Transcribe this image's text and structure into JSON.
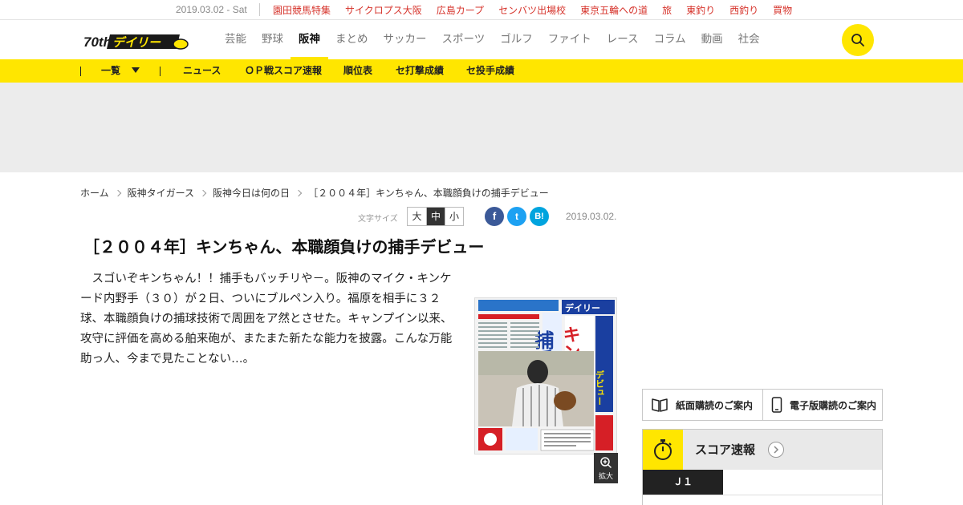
{
  "topbar": {
    "date": "2019.03.02 - Sat",
    "links": [
      "園田競馬特集",
      "サイクロプス大阪",
      "広島カープ",
      "センバツ出場校",
      "東京五輪への道",
      "旅",
      "東釣り",
      "西釣り",
      "買物"
    ]
  },
  "header": {
    "logo_text": "デイリー",
    "logo_badge": "70th",
    "nav": [
      "芸能",
      "野球",
      "阪神",
      "まとめ",
      "サッカー",
      "スポーツ",
      "ゴルフ",
      "ファイト",
      "レース",
      "コラム",
      "動画",
      "社会"
    ],
    "active_nav": "阪神"
  },
  "subnav": {
    "list_label": "一覧",
    "items": [
      "ニュース",
      "ＯＰ戦スコア速報",
      "順位表",
      "セ打撃成績",
      "セ投手成績"
    ]
  },
  "breadcrumb": [
    "ホーム",
    "阪神タイガース",
    "阪神今日は何の日",
    "［２００４年］キンちゃん、本職顔負けの捕手デビュー"
  ],
  "tools": {
    "fontsize_label": "文字サイズ",
    "sizes": [
      "大",
      "中",
      "小"
    ],
    "selected_size": "中",
    "share": [
      "f",
      "t",
      "B!"
    ],
    "date": "2019.03.02."
  },
  "article": {
    "title": "［２００４年］キンちゃん、本職顔負けの捕手デビュー",
    "body": "スゴいぞキンちゃん！！捕手もバッチリや－。阪神のマイク・キンケード内野手（３０）が２日、ついにブルペン入り。福原を相手に３２球、本職顔負けの捕球技術で周囲をア然とさせた。キャンプイン以来、攻守に評価を高める舶来砲が、またまた新たな能力を披露。こんな万能助っ人、今まで見たことない…。",
    "zoom_label": "拡大",
    "paper": {
      "masthead": "デイリー",
      "headline_1": "捕手",
      "headline_2": "キンちゃん",
      "headline_3": "デビュー"
    }
  },
  "sidebar": {
    "subscribe": [
      "紙面購読のご案内",
      "電子版購読のご案内"
    ],
    "score_title": "スコア速報",
    "score_tab": "Ｊ１"
  },
  "colors": {
    "brand_yellow": "#ffe600",
    "link_red": "#d6332b",
    "facebook": "#3b5998",
    "twitter": "#1da1f2",
    "hatena": "#00a4de"
  }
}
